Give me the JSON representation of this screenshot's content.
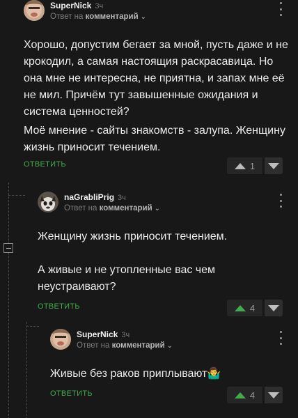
{
  "comments": [
    {
      "author": "SuperNick",
      "age": "3ч",
      "reply_prefix": "Ответ на",
      "reply_target": "комментарий",
      "paragraphs": [
        "Хорошо, допустим бегает за мной, пусть даже и не крокодил, а самая настоящия раскрасавица. Но она мне не интересна, не приятна, и запах мне её не мил. Причём тут завышенные ожидания и система ценностей?",
        "Моё мнение - сайты знакомств - залупа. Женщину жизнь приносит течением."
      ],
      "reply_label": "ОТВЕТИТЬ",
      "votes": "1",
      "vote_state": "neutral"
    },
    {
      "author": "naGrabliPrig",
      "age": "3ч",
      "reply_prefix": "Ответ на",
      "reply_target": "комментарий",
      "paragraphs": [
        "Женщину жизнь приносит течением.",
        "А живые и не утопленные вас чем неустраивают?"
      ],
      "reply_label": "ОТВЕТИТЬ",
      "votes": "4",
      "vote_state": "upvoted"
    },
    {
      "author": "SuperNick",
      "age": "3ч",
      "reply_prefix": "Ответ на",
      "reply_target": "комментарий",
      "paragraphs": [
        "Живые без раков приплывают🤷‍♂️"
      ],
      "reply_label": "ОТВЕТИТЬ",
      "votes": "4",
      "vote_state": "upvoted"
    }
  ],
  "colors": {
    "background": "#181818",
    "accent_green": "#3eae4b",
    "upvote_neutral": "#b9b9b9"
  },
  "icons": {
    "chevron": "⌄"
  }
}
